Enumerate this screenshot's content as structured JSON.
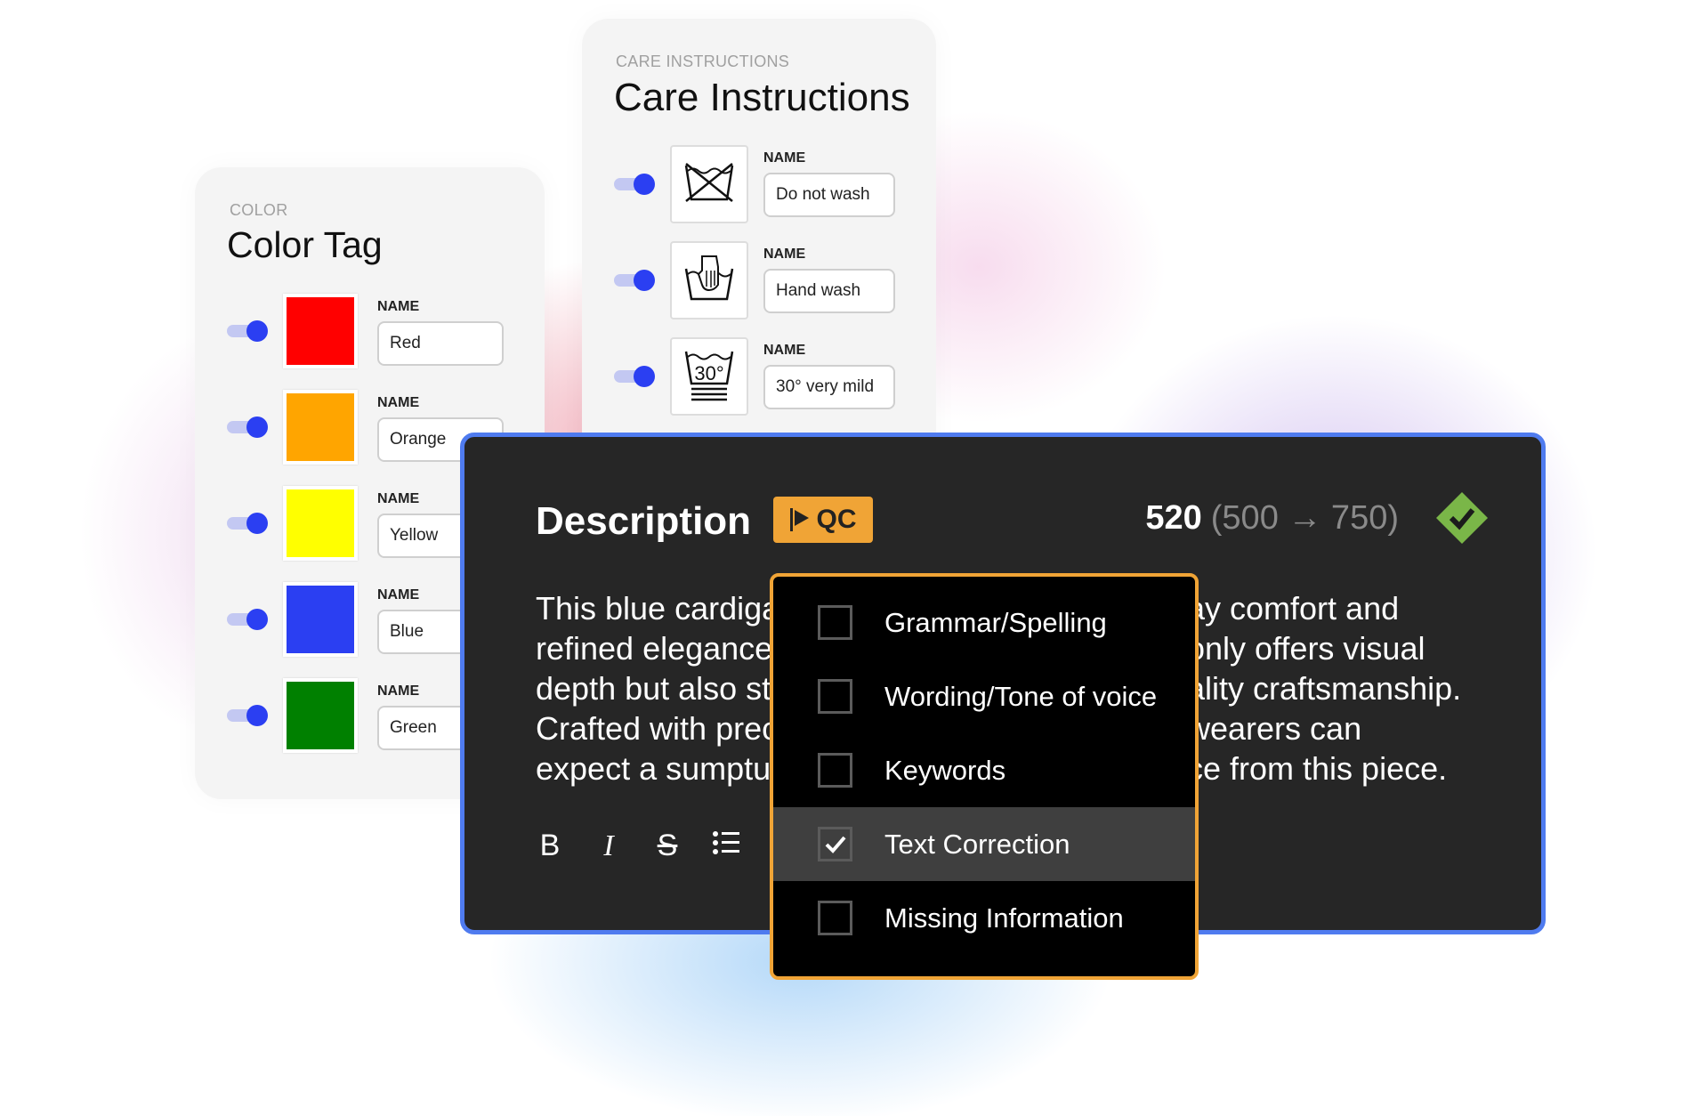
{
  "color_card": {
    "eyebrow": "COLOR",
    "title": "Color Tag",
    "field_label": "NAME",
    "items": [
      {
        "name": "Red",
        "color": "#ff0000",
        "enabled": true
      },
      {
        "name": "Orange",
        "color": "#ffa500",
        "enabled": true
      },
      {
        "name": "Yellow",
        "color": "#ffff00",
        "enabled": true
      },
      {
        "name": "Blue",
        "color": "#2b3ff2",
        "enabled": true
      },
      {
        "name": "Green",
        "color": "#008000",
        "enabled": true
      }
    ]
  },
  "care_card": {
    "eyebrow": "CARE INSTRUCTIONS",
    "title": "Care Instructions",
    "field_label": "NAME",
    "items": [
      {
        "name": "Do not wash",
        "icon": "do-not-wash-icon",
        "enabled": true
      },
      {
        "name": "Hand wash",
        "icon": "hand-wash-icon",
        "enabled": true
      },
      {
        "name": "30° very mild",
        "icon": "wash-30-very-mild-icon",
        "enabled": true
      }
    ]
  },
  "description": {
    "title": "Description",
    "qc_label": "QC",
    "count": "520",
    "range": "(500 → 750)",
    "status": "valid",
    "body_left": [
      "This blue cardiga",
      "refined elegance",
      "depth but also st",
      "Crafted with prec",
      "expect a sumptu"
    ],
    "body_right": [
      "ay comfort and",
      "only offers visual",
      "ality craftsmanship.",
      "wearers can",
      "ce from this piece."
    ],
    "toolbar": [
      "B",
      "I",
      "S",
      "list"
    ]
  },
  "qc_menu": {
    "items": [
      {
        "label": "Grammar/Spelling",
        "checked": false
      },
      {
        "label": "Wording/Tone of voice",
        "checked": false
      },
      {
        "label": "Keywords",
        "checked": false
      },
      {
        "label": "Text Correction",
        "checked": true
      },
      {
        "label": "Missing Information",
        "checked": false
      }
    ]
  },
  "colors": {
    "accent": "#2b3ff2",
    "qc": "#f0a436",
    "panel_border": "#4f7bef",
    "valid": "#7ab648"
  }
}
